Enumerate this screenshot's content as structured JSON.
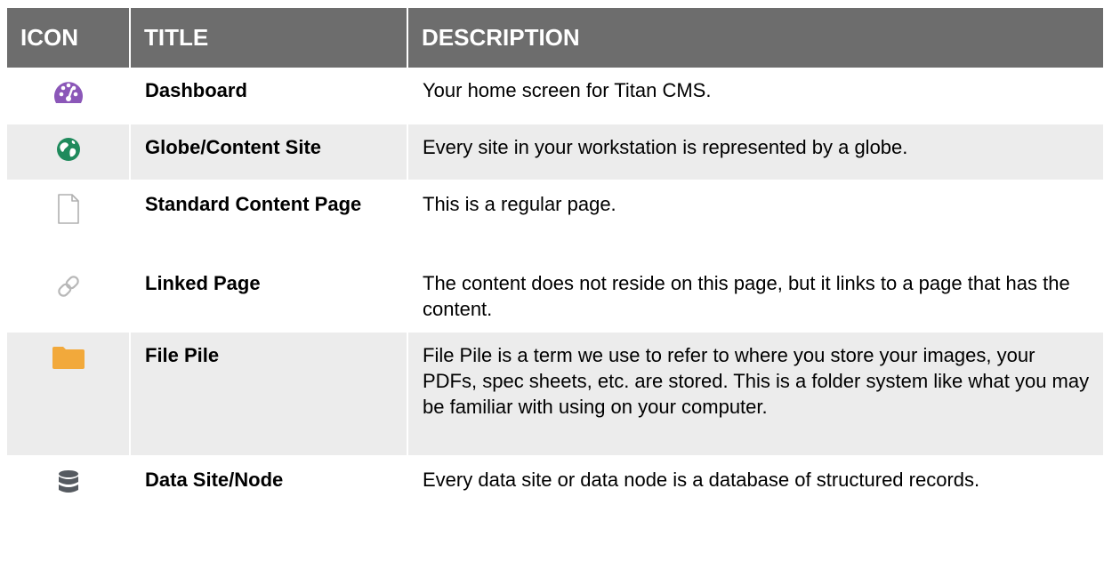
{
  "table": {
    "headers": {
      "icon": "ICON",
      "title": "TITLE",
      "description": "DESCRIPTION"
    },
    "rows": [
      {
        "icon": "dashboard-gauge-icon",
        "title": "Dashboard",
        "description": "Your home screen for Titan CMS."
      },
      {
        "icon": "globe-icon",
        "title": "Globe/Content Site",
        "description": "Every site in your workstation is represented by a globe."
      },
      {
        "icon": "page-icon",
        "title": "Standard Content Page",
        "description": "This is a regular page."
      },
      {
        "icon": "link-icon",
        "title": "Linked Page",
        "description": "The content does not reside on this page, but it links to a page that has the content."
      },
      {
        "icon": "folder-icon",
        "title": "File Pile",
        "description": "File Pile is a term we use to refer to where you store your images, your PDFs, spec sheets, etc. are stored. This is a folder system like what you may be familiar with using on your computer."
      },
      {
        "icon": "database-icon",
        "title": "Data Site/Node",
        "description": "Every data site or data node is a database of structured records."
      }
    ]
  },
  "colors": {
    "header_bg": "#6d6d6d",
    "header_text": "#ffffff",
    "row_shade": "#ececec",
    "dashboard_icon": "#8b57b8",
    "globe_icon": "#1f8a5c",
    "folder_icon": "#f2a93b",
    "database_icon": "#555a60",
    "page_icon": "#b0b0b0",
    "link_icon": "#b8b8b8"
  }
}
